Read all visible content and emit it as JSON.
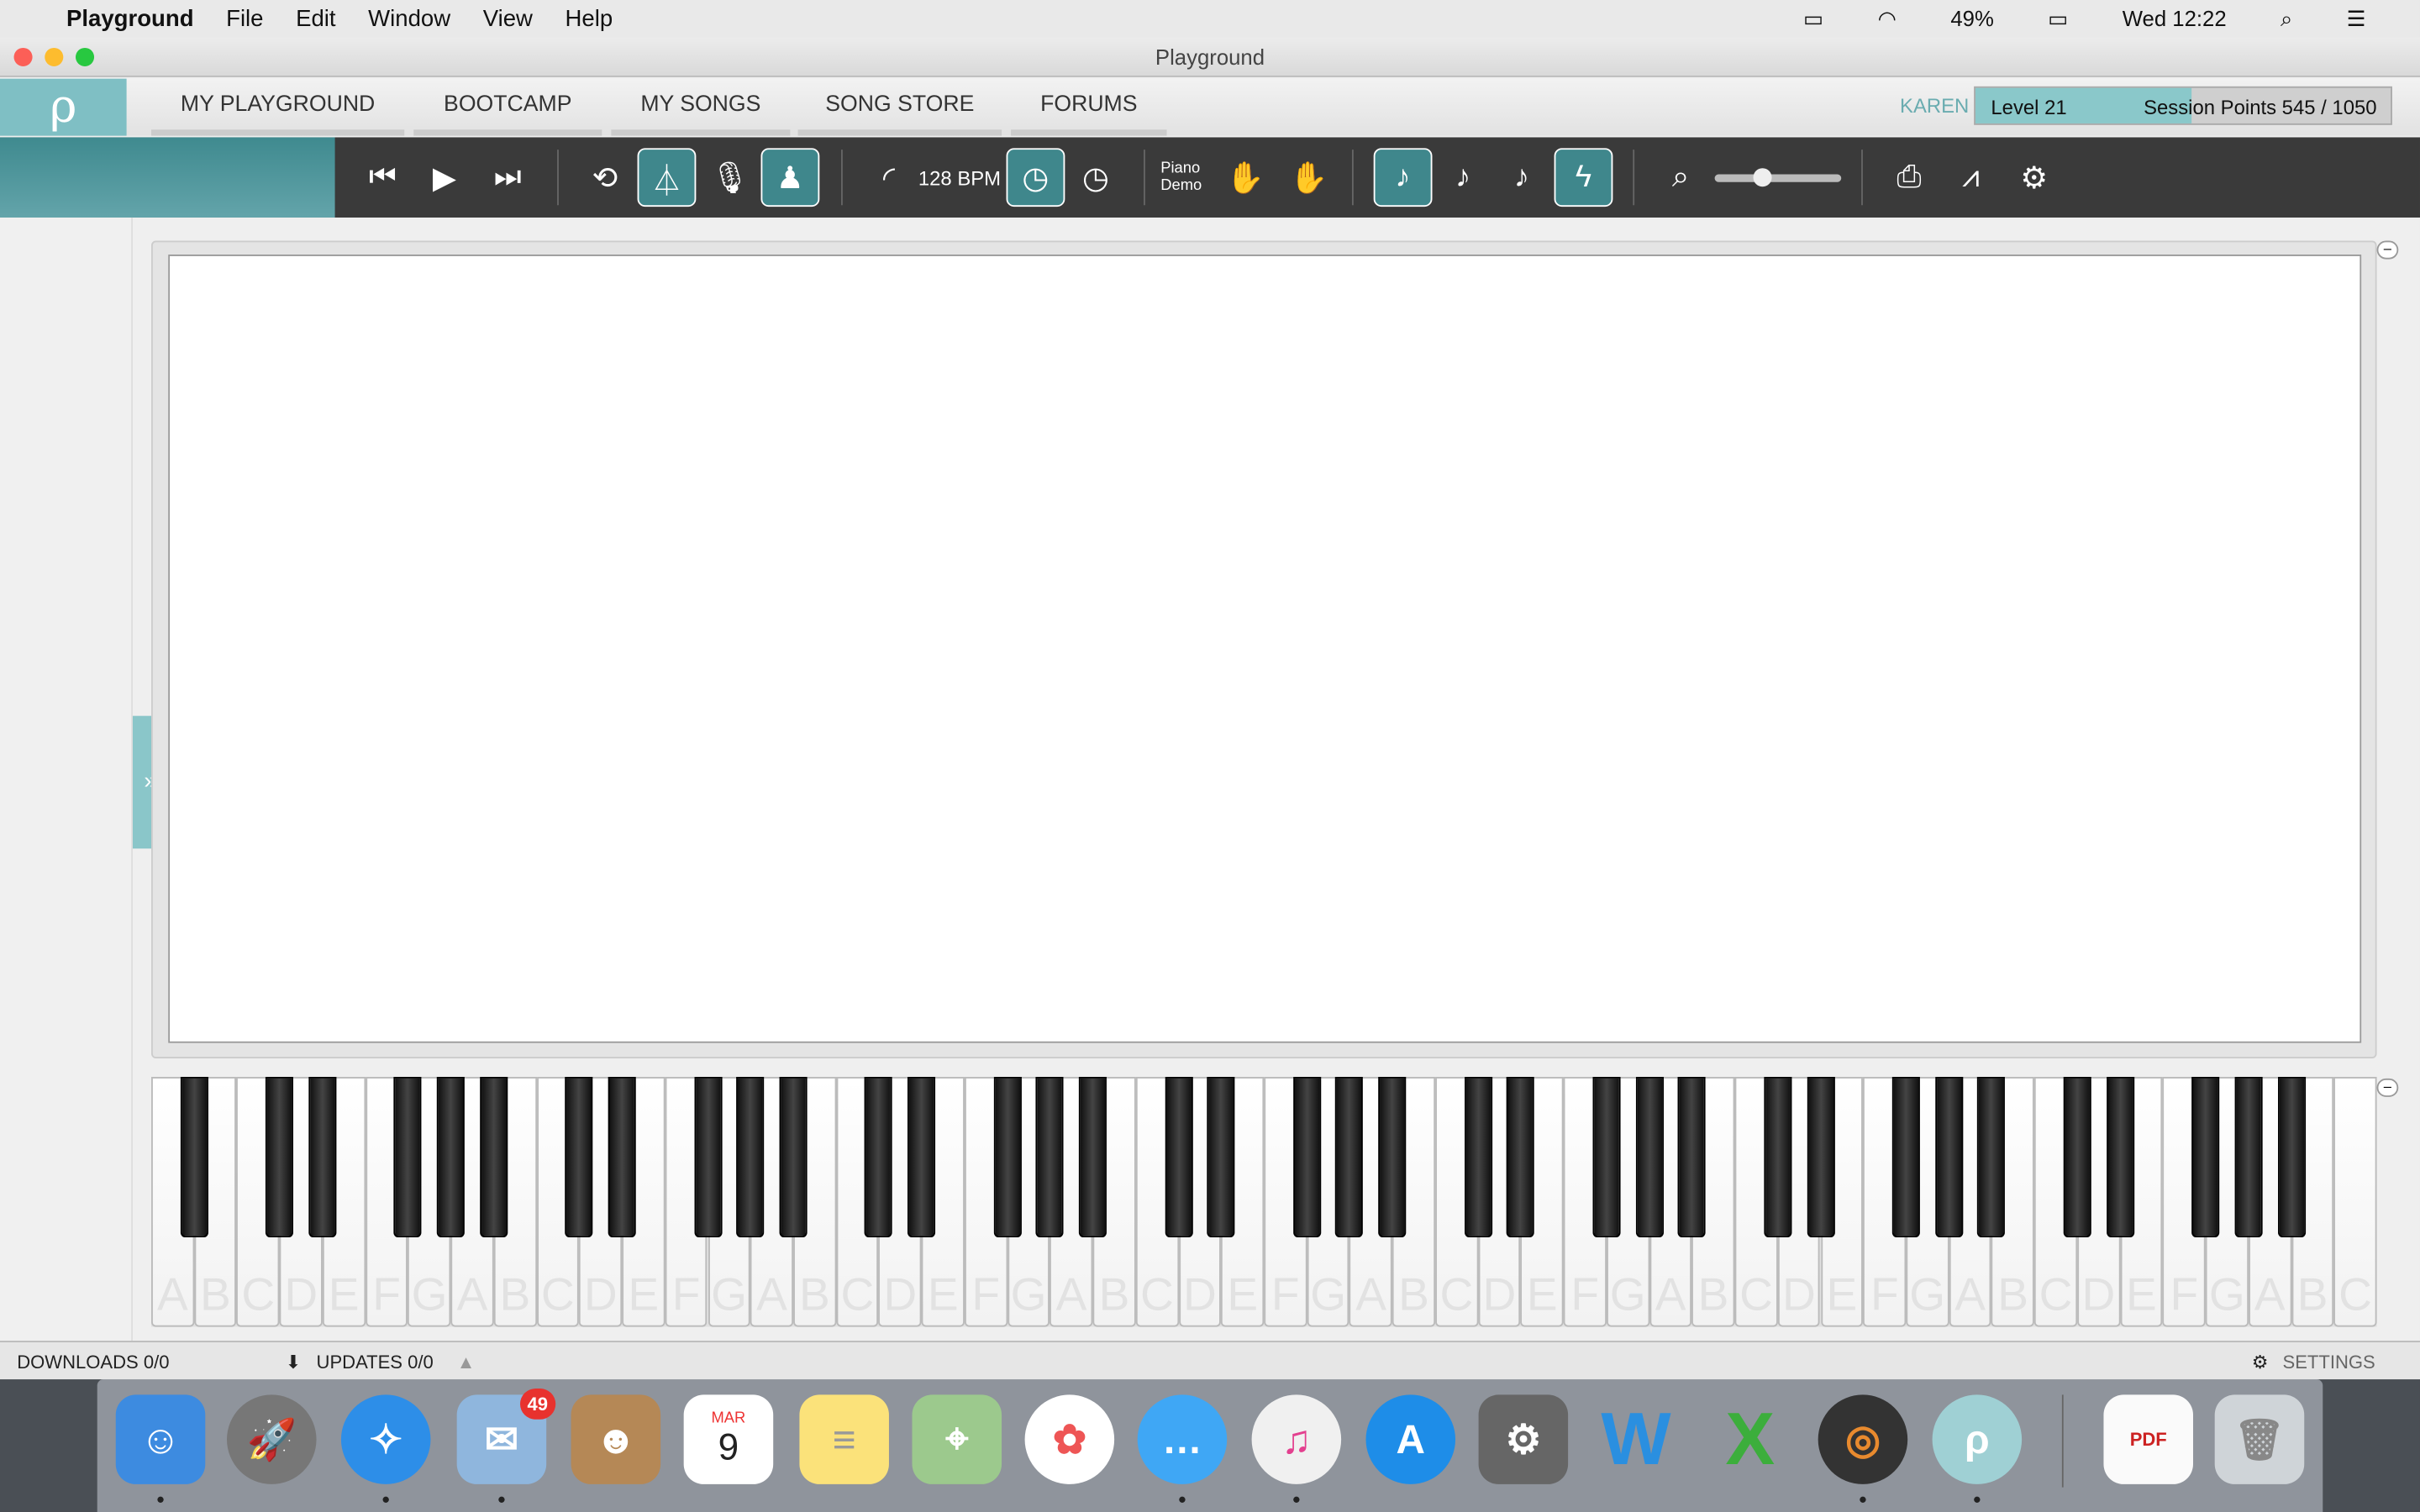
{
  "menubar": {
    "app": "Playground",
    "items": [
      "File",
      "Edit",
      "Window",
      "View",
      "Help"
    ],
    "battery": "49%",
    "clock": "Wed 12:22"
  },
  "window": {
    "title": "Playground"
  },
  "nav": {
    "items": [
      "MY PLAYGROUND",
      "BOOTCAMP",
      "MY SONGS",
      "SONG STORE",
      "FORUMS"
    ],
    "user": "KAREN",
    "level": "Level 21",
    "points": "Session Points 545 / 1050",
    "points_progress": 0.519
  },
  "toolbar": {
    "bpm": "128 BPM",
    "piano_demo_line1": "Piano",
    "piano_demo_line2": "Demo",
    "zoom_level": 0.35
  },
  "piano": {
    "white_key_labels": "ABCDEFGABCDEFGABCDEFGABCDEFGABCDEFGABCDEFGABCDEFGABC"
  },
  "status": {
    "downloads": "DOWNLOADS 0/0",
    "updates": "UPDATES 0/0",
    "settings": "SETTINGS"
  },
  "dock": {
    "mail_badge": "49",
    "calendar_month": "MAR",
    "calendar_day": "9"
  },
  "colors": {
    "accent": "#3f878c",
    "accent_light": "#8ac6c9"
  }
}
